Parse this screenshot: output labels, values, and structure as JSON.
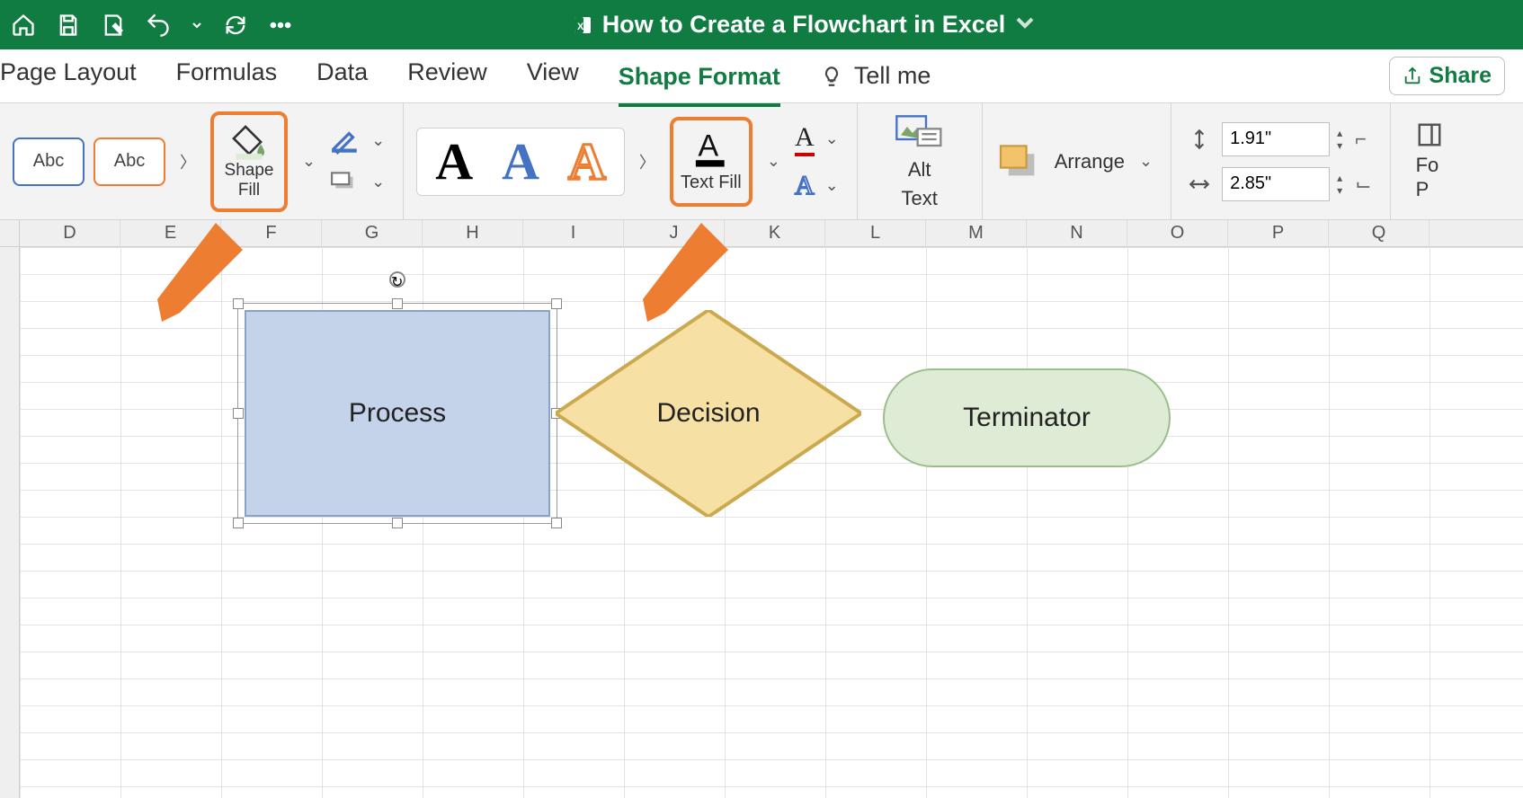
{
  "titlebar": {
    "document_title": "How to Create a Flowchart in Excel"
  },
  "tabs": {
    "page_layout": "Page Layout",
    "formulas": "Formulas",
    "data": "Data",
    "review": "Review",
    "view": "View",
    "shape_format": "Shape Format",
    "tell_me": "Tell me"
  },
  "share_label": "Share",
  "ribbon": {
    "style_thumb_text": "Abc",
    "shape_fill_label_1": "Shape",
    "shape_fill_label_2": "Fill",
    "text_fill_label": "Text Fill",
    "alt_text_label_1": "Alt",
    "alt_text_label_2": "Text",
    "arrange_label": "Arrange",
    "height_value": "1.91\"",
    "width_value": "2.85\"",
    "format_pane_1": "Fo",
    "format_pane_2": "P"
  },
  "columns": [
    "D",
    "E",
    "F",
    "G",
    "H",
    "I",
    "J",
    "K",
    "L",
    "M",
    "N",
    "O",
    "P",
    "Q"
  ],
  "shapes": {
    "process": "Process",
    "decision": "Decision",
    "terminator": "Terminator"
  }
}
